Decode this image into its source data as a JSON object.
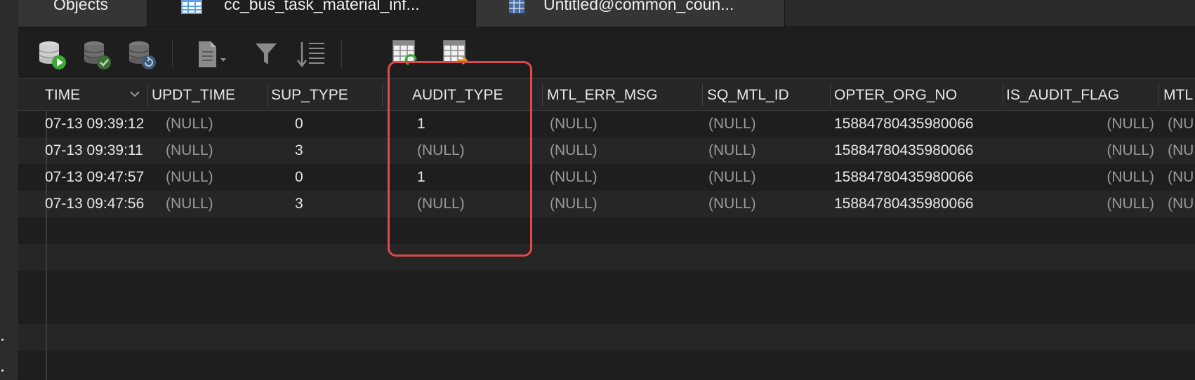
{
  "tabs": [
    {
      "label": "Objects"
    },
    {
      "label": "cc_bus_task_material_inf..."
    },
    {
      "label": "Untitled@common_coun..."
    }
  ],
  "toolbar": {
    "icons": [
      "db-run-icon",
      "db-check-icon",
      "db-refresh-icon",
      "document-icon",
      "filter-icon",
      "sort-icon",
      "table-import-icon",
      "table-export-icon"
    ]
  },
  "grid": {
    "columns": [
      "TIME",
      "UPDT_TIME",
      "SUP_TYPE",
      "AUDIT_TYPE",
      "MTL_ERR_MSG",
      "SQ_MTL_ID",
      "OPTER_ORG_NO",
      "IS_AUDIT_FLAG",
      "MTL"
    ],
    "rows": [
      [
        "07-13 09:39:12",
        "(NULL)",
        "0",
        "1",
        "(NULL)",
        "(NULL)",
        "15884780435980066",
        "(NULL)",
        "(NU"
      ],
      [
        "07-13 09:39:11",
        "(NULL)",
        "3",
        "(NULL)",
        "(NULL)",
        "(NULL)",
        "15884780435980066",
        "(NULL)",
        "(NU"
      ],
      [
        "07-13 09:47:57",
        "(NULL)",
        "0",
        "1",
        "(NULL)",
        "(NULL)",
        "15884780435980066",
        "(NULL)",
        "(NU"
      ],
      [
        "07-13 09:47:56",
        "(NULL)",
        "3",
        "(NULL)",
        "(NULL)",
        "(NULL)",
        "15884780435980066",
        "(NULL)",
        "(NU"
      ]
    ]
  },
  "colors": {
    "highlight": "#e04949",
    "accent": "#5aa1e8"
  }
}
